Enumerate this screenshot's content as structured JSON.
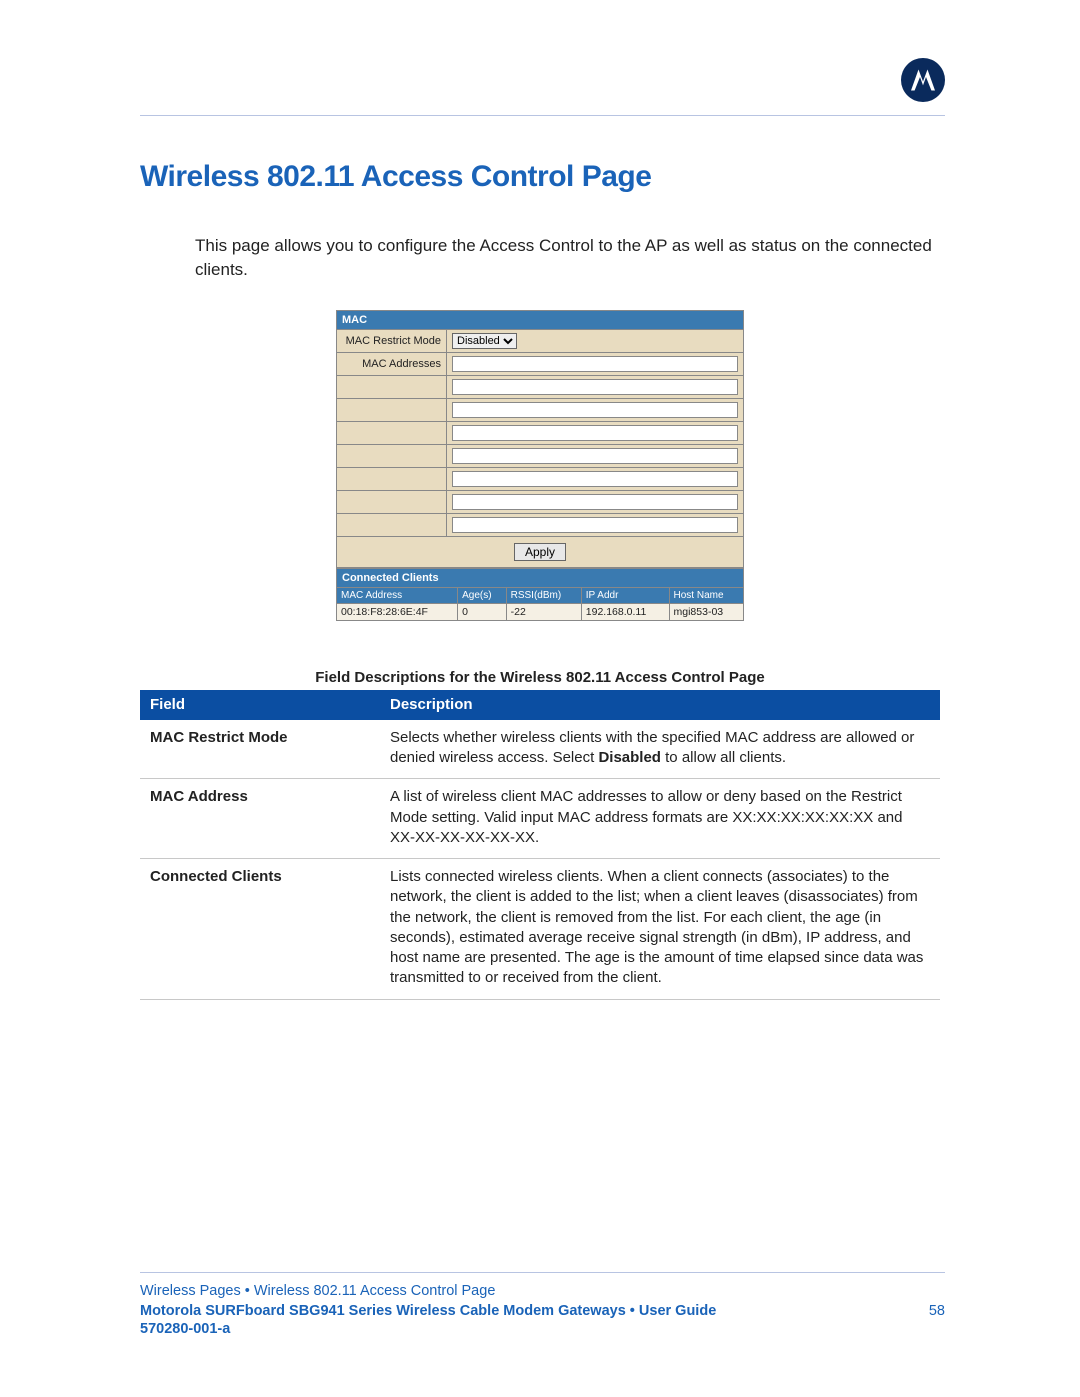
{
  "header": {
    "logo_name": "motorola-logo"
  },
  "title": "Wireless 802.11 Access Control Page",
  "intro": "This page allows you to configure the Access Control to the AP as well as status on the connected clients.",
  "ui": {
    "mac_header": "MAC",
    "restrict_label": "MAC Restrict Mode",
    "restrict_value": "Disabled",
    "addresses_label": "MAC Addresses",
    "mac_inputs": [
      "",
      "",
      "",
      "",
      "",
      "",
      "",
      ""
    ],
    "apply_label": "Apply",
    "cc_header": "Connected Clients",
    "cc_cols": [
      "MAC Address",
      "Age(s)",
      "RSSI(dBm)",
      "IP Addr",
      "Host Name"
    ],
    "cc_rows": [
      {
        "mac": "00:18:F8:28:6E:4F",
        "age": "0",
        "rssi": "-22",
        "ip": "192.168.0.11",
        "host": "mgi853-03"
      }
    ]
  },
  "fd": {
    "caption": "Field Descriptions for the Wireless 802.11 Access Control Page",
    "head_field": "Field",
    "head_desc": "Description",
    "rows": [
      {
        "name": "MAC Restrict Mode",
        "desc_pre": "Selects whether wireless clients with the specified MAC address are allowed or denied wireless access. Select ",
        "desc_bold": "Disabled",
        "desc_post": " to allow all clients."
      },
      {
        "name": "MAC Address",
        "desc_pre": "A list of wireless client MAC addresses to allow or deny based on the Restrict Mode setting. Valid input MAC address formats are XX:XX:XX:XX:XX:XX and XX-XX-XX-XX-XX-XX.",
        "desc_bold": "",
        "desc_post": ""
      },
      {
        "name": "Connected Clients",
        "desc_pre": "Lists connected wireless clients. When a client connects (associates) to the network, the client is added to the list; when a client leaves (disassociates) from the network, the client is removed from the list. For each client, the age (in seconds), estimated average receive signal strength (in dBm), IP address, and host name are presented. The age is the amount of time elapsed since data was transmitted to or received from the client.",
        "desc_bold": "",
        "desc_post": ""
      }
    ]
  },
  "footer": {
    "breadcrumb": "Wireless Pages • Wireless 802.11 Access Control Page",
    "guide": "Motorola SURFboard SBG941 Series Wireless Cable Modem Gateways • User Guide",
    "page": "58",
    "docno": "570280-001-a"
  }
}
